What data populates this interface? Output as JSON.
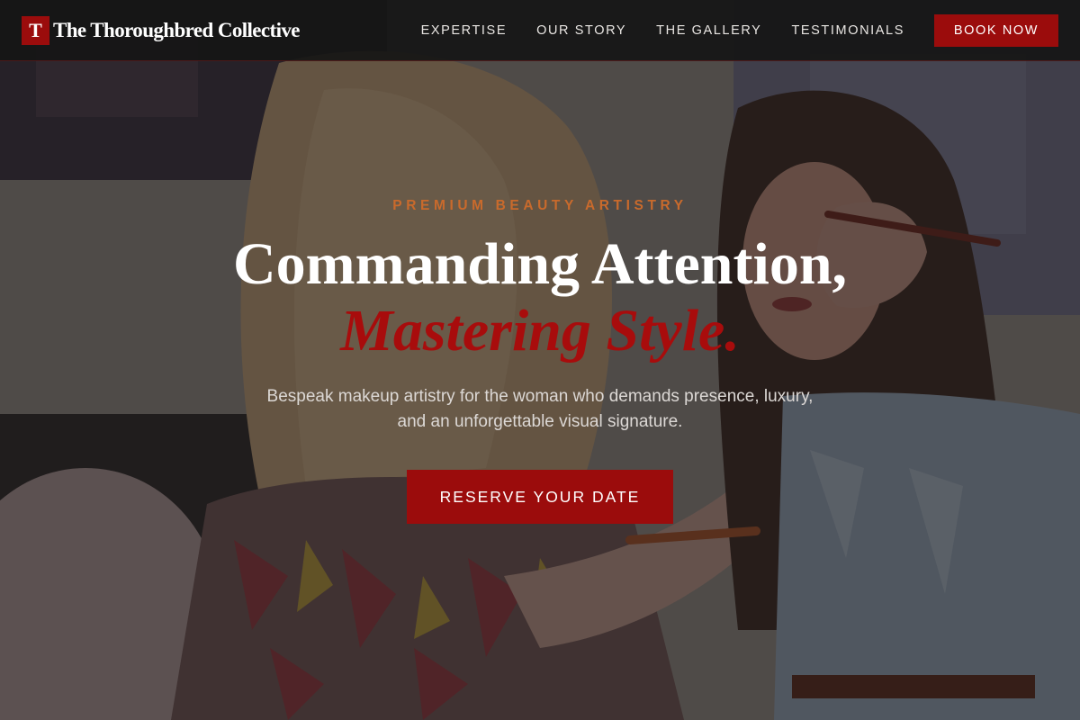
{
  "nav": {
    "brand_mark": "T",
    "brand_name": "The Thoroughbred Collective",
    "links": [
      {
        "label": "EXPERTISE"
      },
      {
        "label": "OUR STORY"
      },
      {
        "label": "THE GALLERY"
      },
      {
        "label": "TESTIMONIALS"
      }
    ],
    "cta_label": "BOOK NOW"
  },
  "hero": {
    "eyebrow": "PREMIUM BEAUTY ARTISTRY",
    "headline_line1": "Commanding Attention,",
    "headline_line2": "Mastering Style.",
    "subtext": "Bespeak makeup artistry for the woman who demands presence, luxury, and an unforgettable visual signature.",
    "cta_label": "RESERVE YOUR DATE"
  },
  "colors": {
    "accent_red": "#9b0c0c",
    "headline_red": "#a80c0c",
    "eyebrow_orange": "#c96a2c",
    "nav_background": "#161616"
  }
}
